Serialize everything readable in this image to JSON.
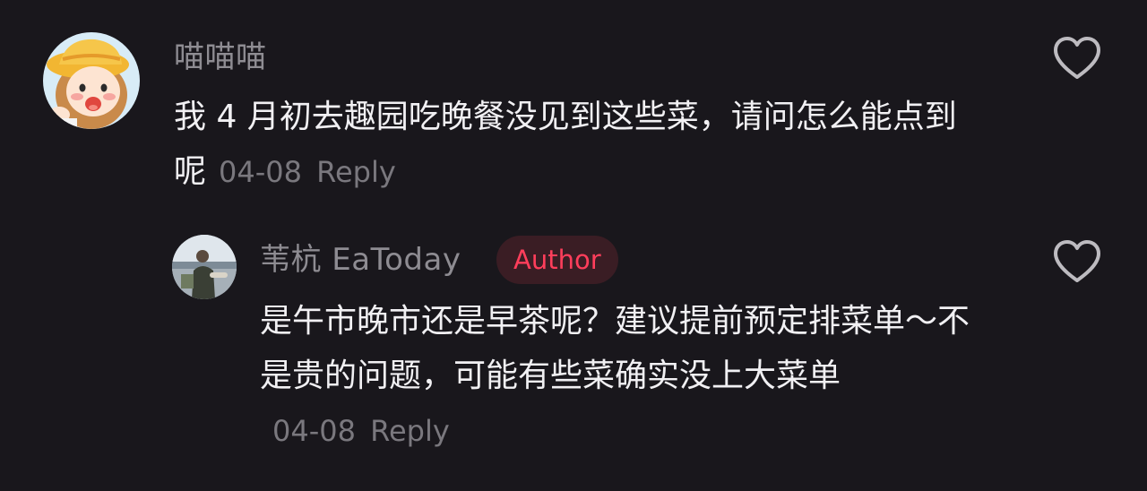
{
  "comments": [
    {
      "username": "喵喵喵",
      "avatar_icon": "cartoon-girl-avatar",
      "text": "我 4 月初去趣园吃晚餐没见到这些菜，请问怎么能点到呢",
      "date": "04-08",
      "reply_label": "Reply",
      "like_icon": "heart-outline-icon"
    },
    {
      "username": "苇杭 EaToday",
      "badge": "Author",
      "avatar_icon": "photo-avatar",
      "text": "是午市晚市还是早茶呢？建议提前预定排菜单～不是贵的问题，可能有些菜确实没上大菜单",
      "date": "04-08",
      "reply_label": "Reply",
      "like_icon": "heart-outline-icon"
    }
  ],
  "colors": {
    "background": "#19171c",
    "text": "#f1f0f3",
    "muted": "#7a787e",
    "badge_text": "#ff3e5b",
    "badge_bg": "#3a1d24"
  }
}
